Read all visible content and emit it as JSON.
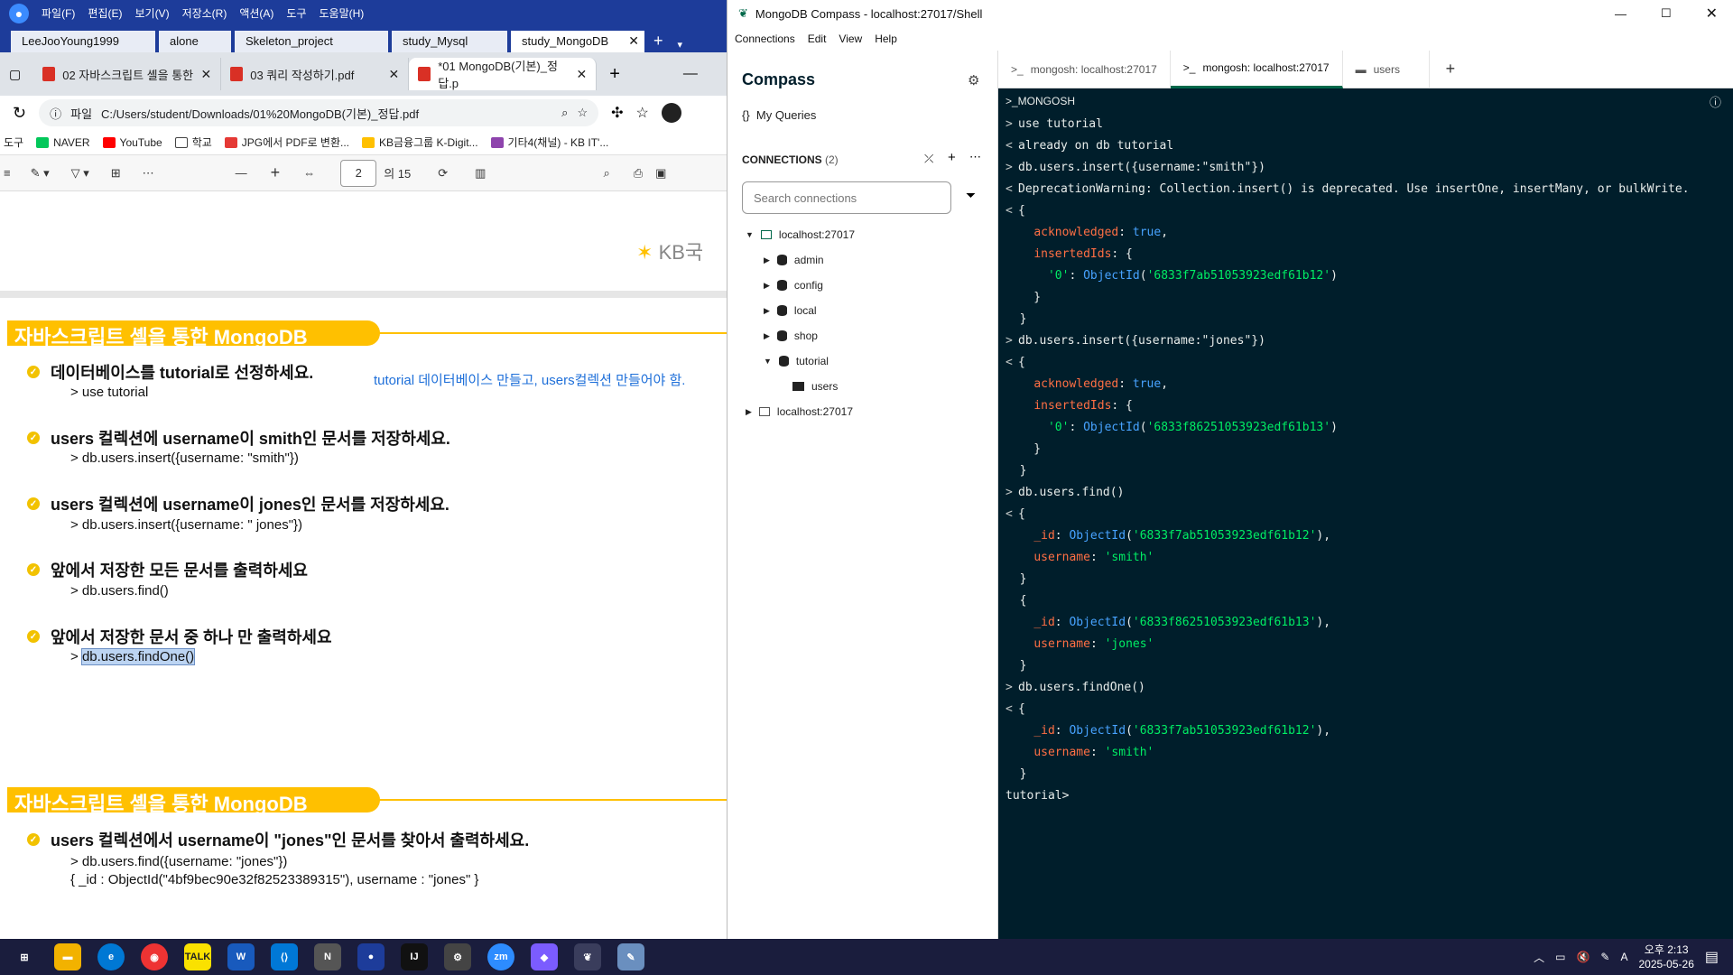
{
  "file_manager": {
    "menus": [
      "파일(F)",
      "편집(E)",
      "보기(V)",
      "저장소(R)",
      "액션(A)",
      "도구",
      "도움말(H)"
    ],
    "tabs": [
      "LeeJooYoung1999",
      "alone",
      "Skeleton_project",
      "study_Mysql",
      "study_MongoDB"
    ]
  },
  "browser": {
    "tabs": [
      "02 자바스크립트 셸을 통한",
      "03 쿼리 작성하기.pdf",
      "*01 MongoDB(기본)_정답.p"
    ],
    "address_prefix": "파일",
    "address": "C:/Users/student/Downloads/01%20MongoDB(기본)_정답.pdf",
    "bookmarks": [
      "도구",
      "NAVER",
      "YouTube",
      "학교",
      "JPG에서 PDF로 변환...",
      "KB금융그룹 K-Digit...",
      "기타4(채널) - KB IT'..."
    ],
    "page_input": "2",
    "page_total": "의 15"
  },
  "pdf": {
    "logo_text": "KB국",
    "section_title": "자바스크립트 셸을 통한 MongoDB",
    "note": "tutorial 데이터베이스 만들고, users컬렉션 만들어야 함.",
    "items": [
      {
        "q": "데이터베이스를 tutorial로 선정하세요.",
        "a": "> use tutorial"
      },
      {
        "q": "users 컬렉션에 username이 smith인 문서를 저장하세요.",
        "a": "> db.users.insert({username: \"smith\"})"
      },
      {
        "q": "users 컬렉션에 username이 jones인 문서를 저장하세요.",
        "a": "> db.users.insert({username: \" jones\"})"
      },
      {
        "q": "앞에서 저장한 모든 문서를 출력하세요",
        "a": "> db.users.find()"
      },
      {
        "q": "앞에서 저장한 문서 중 하나 만 출력하세요",
        "a_prefix": "> ",
        "a": "db.users.findOne()"
      }
    ],
    "section2_title": "자바스크립트 셸을 통한 MongoDB",
    "item2_q": "users 컬렉션에서 username이 \"jones\"인 문서를 찾아서 출력하세요.",
    "item2_a1": "> db.users.find({username: \"jones\"})",
    "item2_a2": "{ _id : ObjectId(\"4bf9bec90e32f82523389315\"), username : \"jones\" }"
  },
  "compass": {
    "window_title": "MongoDB Compass - localhost:27017/Shell",
    "menu": [
      "Connections",
      "Edit",
      "View",
      "Help"
    ],
    "sidebar": {
      "title": "Compass",
      "my_queries": "My Queries",
      "connections_label": "CONNECTIONS",
      "connections_count": "(2)",
      "search_placeholder": "Search connections",
      "conn1": "localhost:27017",
      "dbs": [
        "admin",
        "config",
        "local",
        "shop",
        "tutorial"
      ],
      "collection": "users",
      "conn2": "localhost:27017"
    },
    "tabs": [
      "mongosh: localhost:27017",
      "mongosh: localhost:27017",
      "users"
    ],
    "shell_header": ">_MONGOSH",
    "prompt": "tutorial>"
  },
  "taskbar": {
    "time": "오후 2:13",
    "date": "2025-05-26",
    "ime": "A"
  },
  "colors": {
    "accent": "#ffc000",
    "shell_bg": "#001e2b",
    "compass_green": "#00684a",
    "taskbar": "#1a1d3d"
  }
}
